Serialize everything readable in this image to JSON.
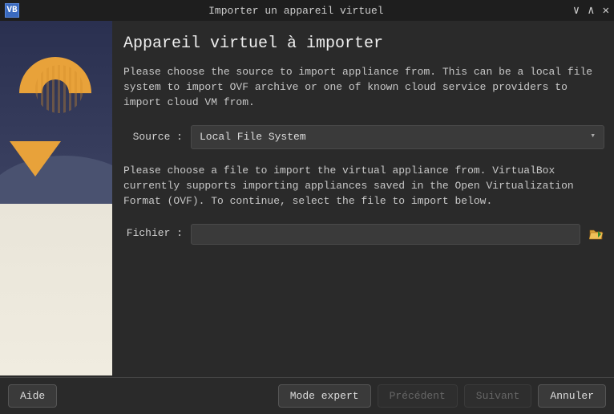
{
  "window": {
    "title": "Importer un appareil virtuel"
  },
  "page": {
    "heading": "Appareil virtuel à importer",
    "intro": "Please choose the source to import appliance from. This can be a local file system to import OVF archive or one of known cloud service providers to import cloud VM from.",
    "source_label": "Source :",
    "source_value": "Local File System",
    "file_desc": "Please choose a file to import the virtual appliance from. VirtualBox currently supports importing appliances saved in the Open Virtualization Format (OVF). To continue, select the file to import below.",
    "file_label": "Fichier :",
    "file_value": ""
  },
  "buttons": {
    "help": "Aide",
    "expert": "Mode expert",
    "back": "Précédent",
    "next": "Suivant",
    "cancel": "Annuler"
  }
}
